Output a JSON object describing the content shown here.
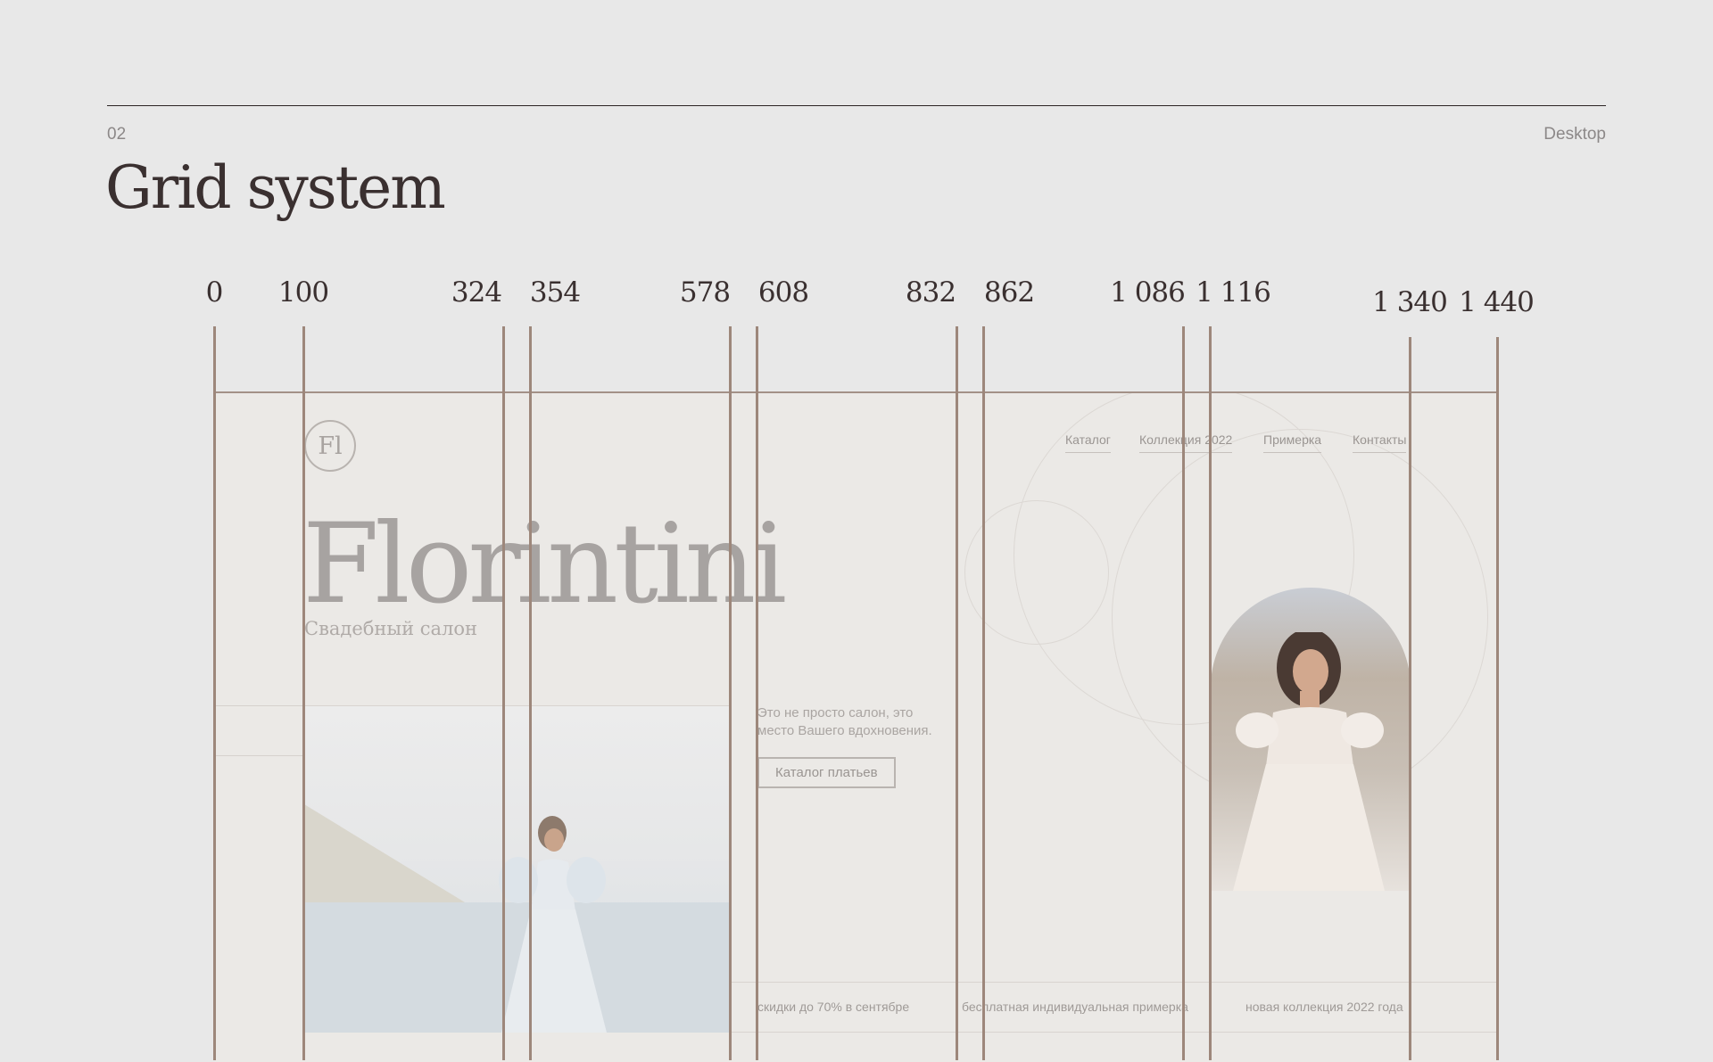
{
  "header": {
    "section_number": "02",
    "mode": "Desktop",
    "title": "Grid system"
  },
  "ruler": {
    "labels": [
      "0",
      "100",
      "324",
      "354",
      "578",
      "608",
      "832",
      "862",
      "1 086",
      "1 116",
      "1 340",
      "1 440"
    ]
  },
  "mockup": {
    "logo_text": "Fl",
    "nav": [
      "Каталог",
      "Коллекция 2022",
      "Примерка",
      "Контакты"
    ],
    "brand": "Florintini",
    "tagline": "Свадебный салон",
    "intro_line1": "Это не просто салон, это",
    "intro_line2": "место Вашего вдохновения.",
    "cta_label": "Каталог платьев",
    "promos": [
      "скидки до 70% в сентябре",
      "бесплатная индивидуальная примерка",
      "новая коллекция 2022 года"
    ]
  },
  "colors": {
    "background": "#e8e8e8",
    "grid_line": "#9d877b",
    "title": "#3a3030"
  }
}
